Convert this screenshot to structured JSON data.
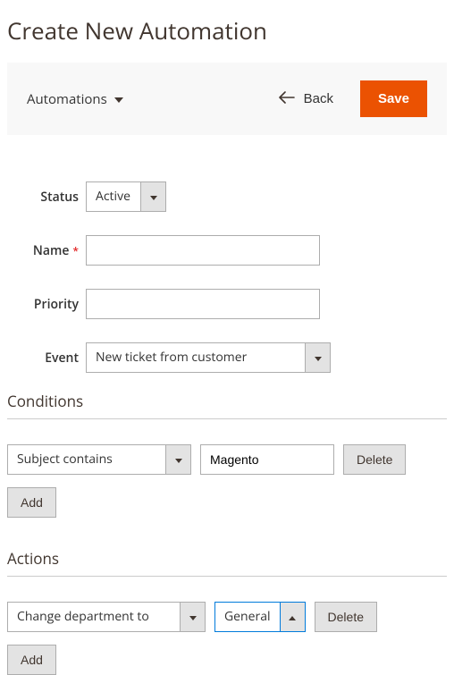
{
  "page": {
    "title": "Create New Automation"
  },
  "toolbar": {
    "menu_label": "Automations",
    "back_label": "Back",
    "save_label": "Save"
  },
  "form": {
    "status": {
      "label": "Status",
      "value": "Active"
    },
    "name": {
      "label": "Name",
      "value": ""
    },
    "priority": {
      "label": "Priority",
      "value": ""
    },
    "event": {
      "label": "Event",
      "value": "New ticket from customer"
    }
  },
  "conditions": {
    "heading": "Conditions",
    "rows": [
      {
        "type": "Subject contains",
        "value": "Magento"
      }
    ],
    "delete_label": "Delete",
    "add_label": "Add"
  },
  "actions": {
    "heading": "Actions",
    "rows": [
      {
        "type": "Change department to",
        "value": "General"
      }
    ],
    "delete_label": "Delete",
    "add_label": "Add"
  }
}
